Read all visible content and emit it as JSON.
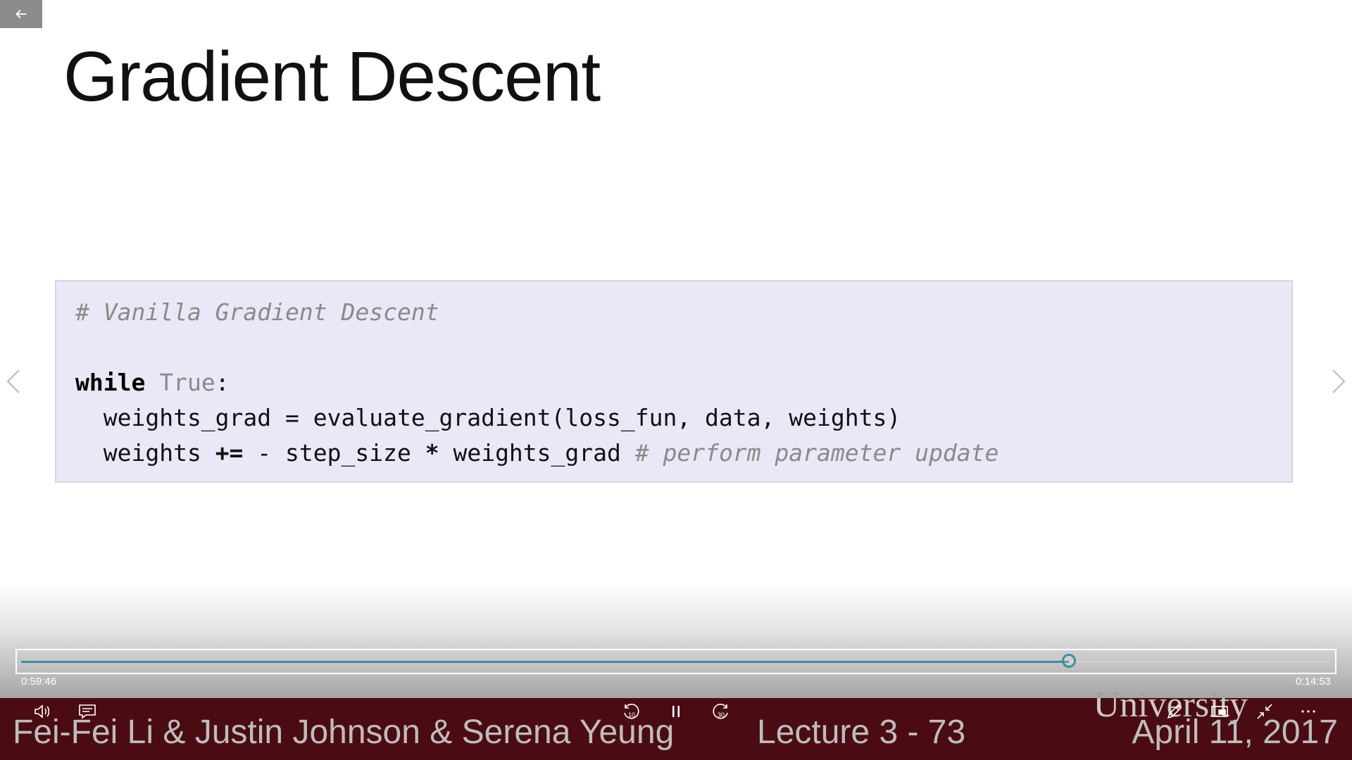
{
  "slide": {
    "title": "Gradient Descent",
    "code": {
      "comment_line": "# Vanilla Gradient Descent",
      "while_keyword": "while",
      "true_constant": "True",
      "colon": ":",
      "line_grad": "  weights_grad = evaluate_gradient(loss_fun, data, weights)",
      "line_update_prefix": "  weights ",
      "line_update_op": "+=",
      "line_update_mid": " - step_size ",
      "line_update_star": "*",
      "line_update_suffix": " weights_grad ",
      "line_update_comment": "# perform parameter update"
    },
    "footer": {
      "names": "Fei-Fei Li & Justin Johnson & Serena Yeung",
      "lecture": "Lecture 3 -   73",
      "date": "April 11, 2017",
      "university": "University"
    }
  },
  "player": {
    "elapsed": "0:59:46",
    "remaining": "0:14:53",
    "progress_fraction": 0.8,
    "accent_color": "#3a8fa0",
    "footer_color": "#4a0c12",
    "icons": {
      "back": "arrow-left-icon",
      "volume": "volume-icon",
      "captions": "captions-icon",
      "skip_back": "skip-back-10-icon",
      "pause": "pause-icon",
      "skip_forward": "skip-forward-30-icon",
      "draw": "pen-icon",
      "miniview": "miniview-icon",
      "exit_fullscreen": "exit-fullscreen-icon",
      "more": "more-icon",
      "prev": "chevron-left-icon",
      "next": "chevron-right-icon"
    }
  }
}
